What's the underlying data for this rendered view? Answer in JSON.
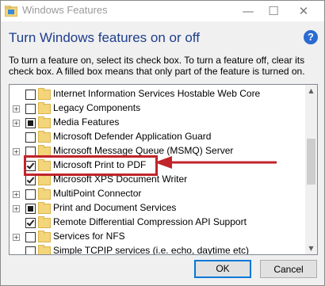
{
  "window": {
    "title": "Windows Features",
    "minimize": "—",
    "maximize": "☐",
    "close": "✕"
  },
  "heading": "Turn Windows features on or off",
  "help_label": "?",
  "description": "To turn a feature on, select its check box. To turn a feature off, clear its check box. A filled box means that only part of the feature is turned on.",
  "features": [
    {
      "label": "Internet Information Services Hostable Web Core",
      "state": "unchecked",
      "expandable": false
    },
    {
      "label": "Legacy Components",
      "state": "unchecked",
      "expandable": true
    },
    {
      "label": "Media Features",
      "state": "partial",
      "expandable": true
    },
    {
      "label": "Microsoft Defender Application Guard",
      "state": "unchecked",
      "expandable": false
    },
    {
      "label": "Microsoft Message Queue (MSMQ) Server",
      "state": "unchecked",
      "expandable": true
    },
    {
      "label": "Microsoft Print to PDF",
      "state": "checked",
      "expandable": false
    },
    {
      "label": "Microsoft XPS Document Writer",
      "state": "checked",
      "expandable": false
    },
    {
      "label": "MultiPoint Connector",
      "state": "unchecked",
      "expandable": true
    },
    {
      "label": "Print and Document Services",
      "state": "partial",
      "expandable": true
    },
    {
      "label": "Remote Differential Compression API Support",
      "state": "checked",
      "expandable": false
    },
    {
      "label": "Services for NFS",
      "state": "unchecked",
      "expandable": true
    },
    {
      "label": "Simple TCPIP services (i.e. echo, daytime etc)",
      "state": "unchecked",
      "expandable": false
    }
  ],
  "expander_glyph": "+",
  "buttons": {
    "ok": "OK",
    "cancel": "Cancel"
  },
  "colors": {
    "heading": "#1e3e8c",
    "annotation": "#c0242a",
    "help": "#2a6bd1"
  }
}
